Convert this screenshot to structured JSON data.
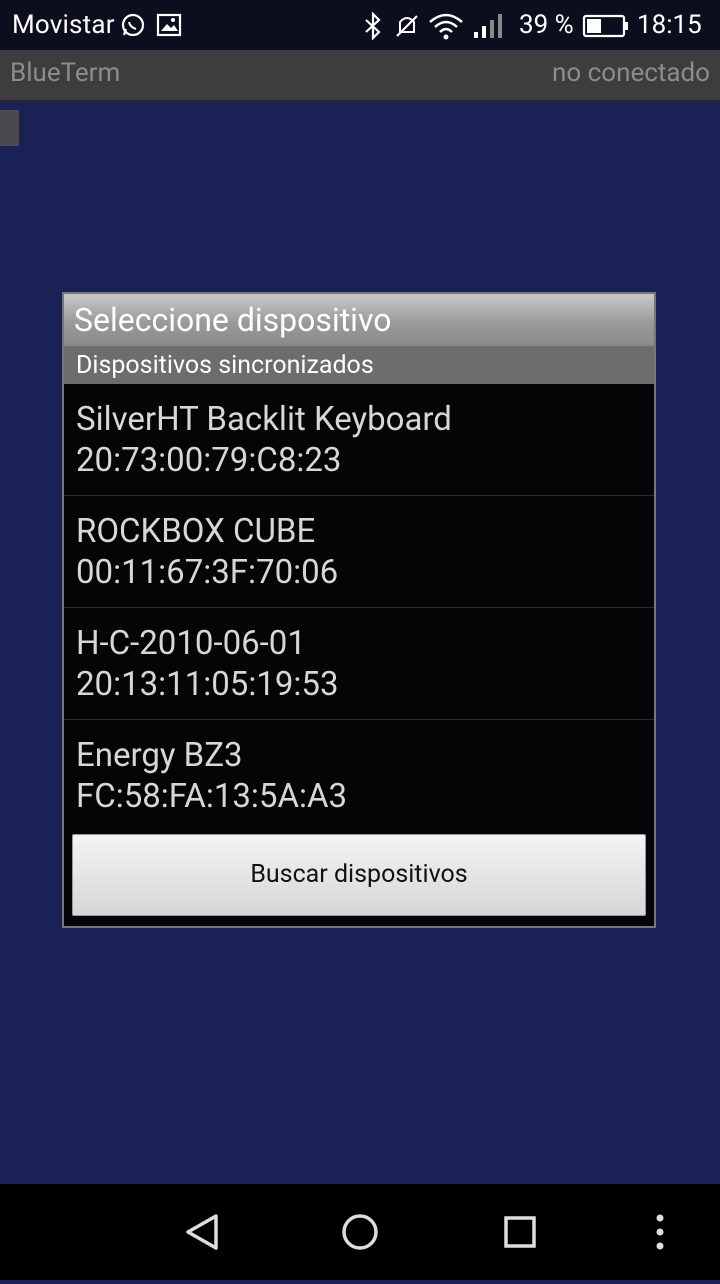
{
  "status_bar": {
    "carrier": "Movistar",
    "battery_percent": "39 %",
    "time": "18:15",
    "icons": [
      "whatsapp-icon",
      "gallery-icon",
      "bluetooth-icon",
      "mute-icon",
      "wifi-icon",
      "signal-icon",
      "battery-icon"
    ]
  },
  "app_bar": {
    "title": "BlueTerm",
    "connection_status": "no conectado"
  },
  "dialog": {
    "title": "Seleccione dispositivo",
    "subtitle": "Dispositivos sincronizados",
    "devices": [
      {
        "name": "SilverHT Backlit Keyboard",
        "address": "20:73:00:79:C8:23"
      },
      {
        "name": "ROCKBOX CUBE",
        "address": "00:11:67:3F:70:06"
      },
      {
        "name": "H-C-2010-06-01",
        "address": "20:13:11:05:19:53"
      },
      {
        "name": "Energy BZ3",
        "address": "FC:58:FA:13:5A:A3"
      }
    ],
    "scan_button": "Buscar dispositivos"
  },
  "nav_bar": {
    "icons": [
      "back-icon",
      "home-icon",
      "recents-icon",
      "menu-icon"
    ]
  }
}
